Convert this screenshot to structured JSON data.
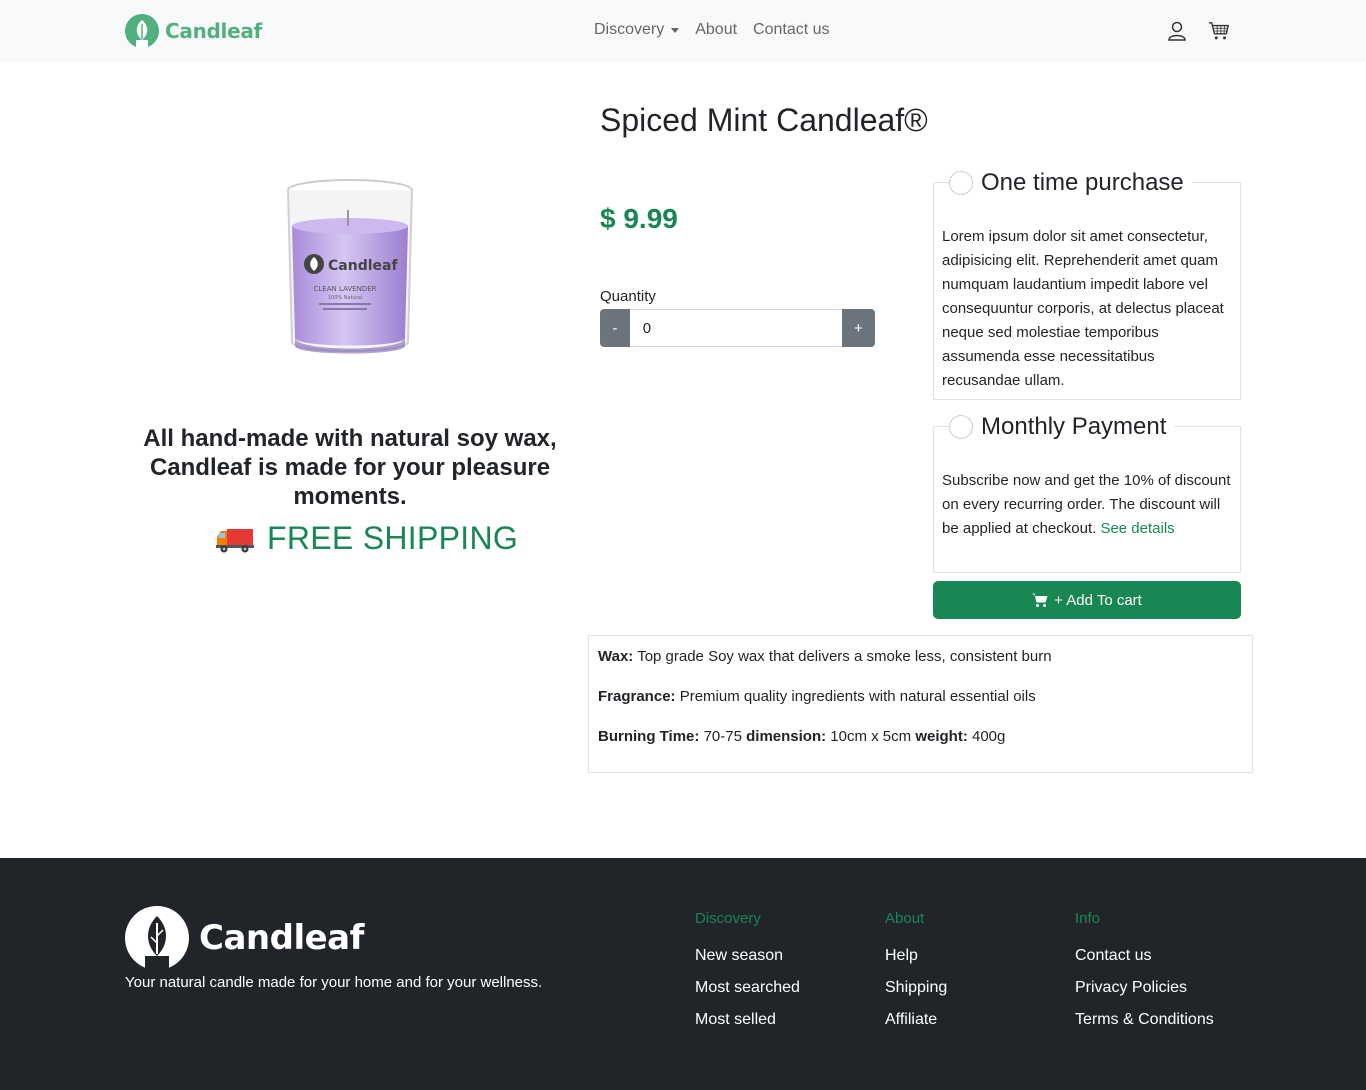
{
  "navbar": {
    "brand": "Candleaf",
    "links": [
      {
        "label": "Discovery",
        "dropdown": true
      },
      {
        "label": "About"
      },
      {
        "label": "Contact us"
      }
    ],
    "icons": [
      "user-icon",
      "cart-icon"
    ]
  },
  "product": {
    "title": "Spiced Mint Candleaf®",
    "price": "$ 9.99",
    "image": {
      "label": "Candleaf",
      "subtitle": "CLEAN LAVENDER",
      "detail": "100% Natural"
    },
    "tagline": "All hand-made with natural soy wax, Candleaf is made for your pleasure moments.",
    "shipping": "FREE SHIPPING",
    "quantity": {
      "label": "Quantity",
      "value": "0",
      "minus": "-",
      "plus": "+"
    },
    "options": [
      {
        "title": "One time purchase",
        "text": "Lorem ipsum dolor sit amet consectetur, adipisicing elit. Reprehenderit amet quam numquam laudantium impedit labore vel consequuntur corporis, at delectus placeat neque sed molestiae temporibus assumenda esse necessitatibus recusandae ullam."
      },
      {
        "title": "Monthly Payment",
        "text": "Subscribe now and get the 10% of discount on every recurring order. The discount will be applied at checkout.",
        "link": "See details"
      }
    ],
    "add_to_cart": "+ Add To cart",
    "specs": {
      "wax_label": "Wax:",
      "wax": "Top grade Soy wax that delivers a smoke less, consistent burn",
      "fragrance_label": "Fragrance:",
      "fragrance": "Premium quality ingredients with natural essential oils",
      "burning_label": "Burning Time:",
      "burning": "70-75",
      "dimension_label": "dimension:",
      "dimension": "10cm x 5cm",
      "weight_label": "weight:",
      "weight": "400g"
    }
  },
  "footer": {
    "brand": "Candleaf",
    "tagline": "Your natural candle made for your home and for your wellness.",
    "columns": [
      {
        "title": "Discovery",
        "links": [
          "New season",
          "Most searched",
          "Most selled"
        ]
      },
      {
        "title": "About",
        "links": [
          "Help",
          "Shipping",
          "Affiliate"
        ]
      },
      {
        "title": "Info",
        "links": [
          "Contact us",
          "Privacy Policies",
          "Terms & Conditions"
        ]
      }
    ]
  },
  "colors": {
    "brand_green": "#52b07f",
    "success": "#198754",
    "dark": "#212529",
    "secondary": "#6c757d",
    "candle_lavender": "#c9b4ec"
  }
}
